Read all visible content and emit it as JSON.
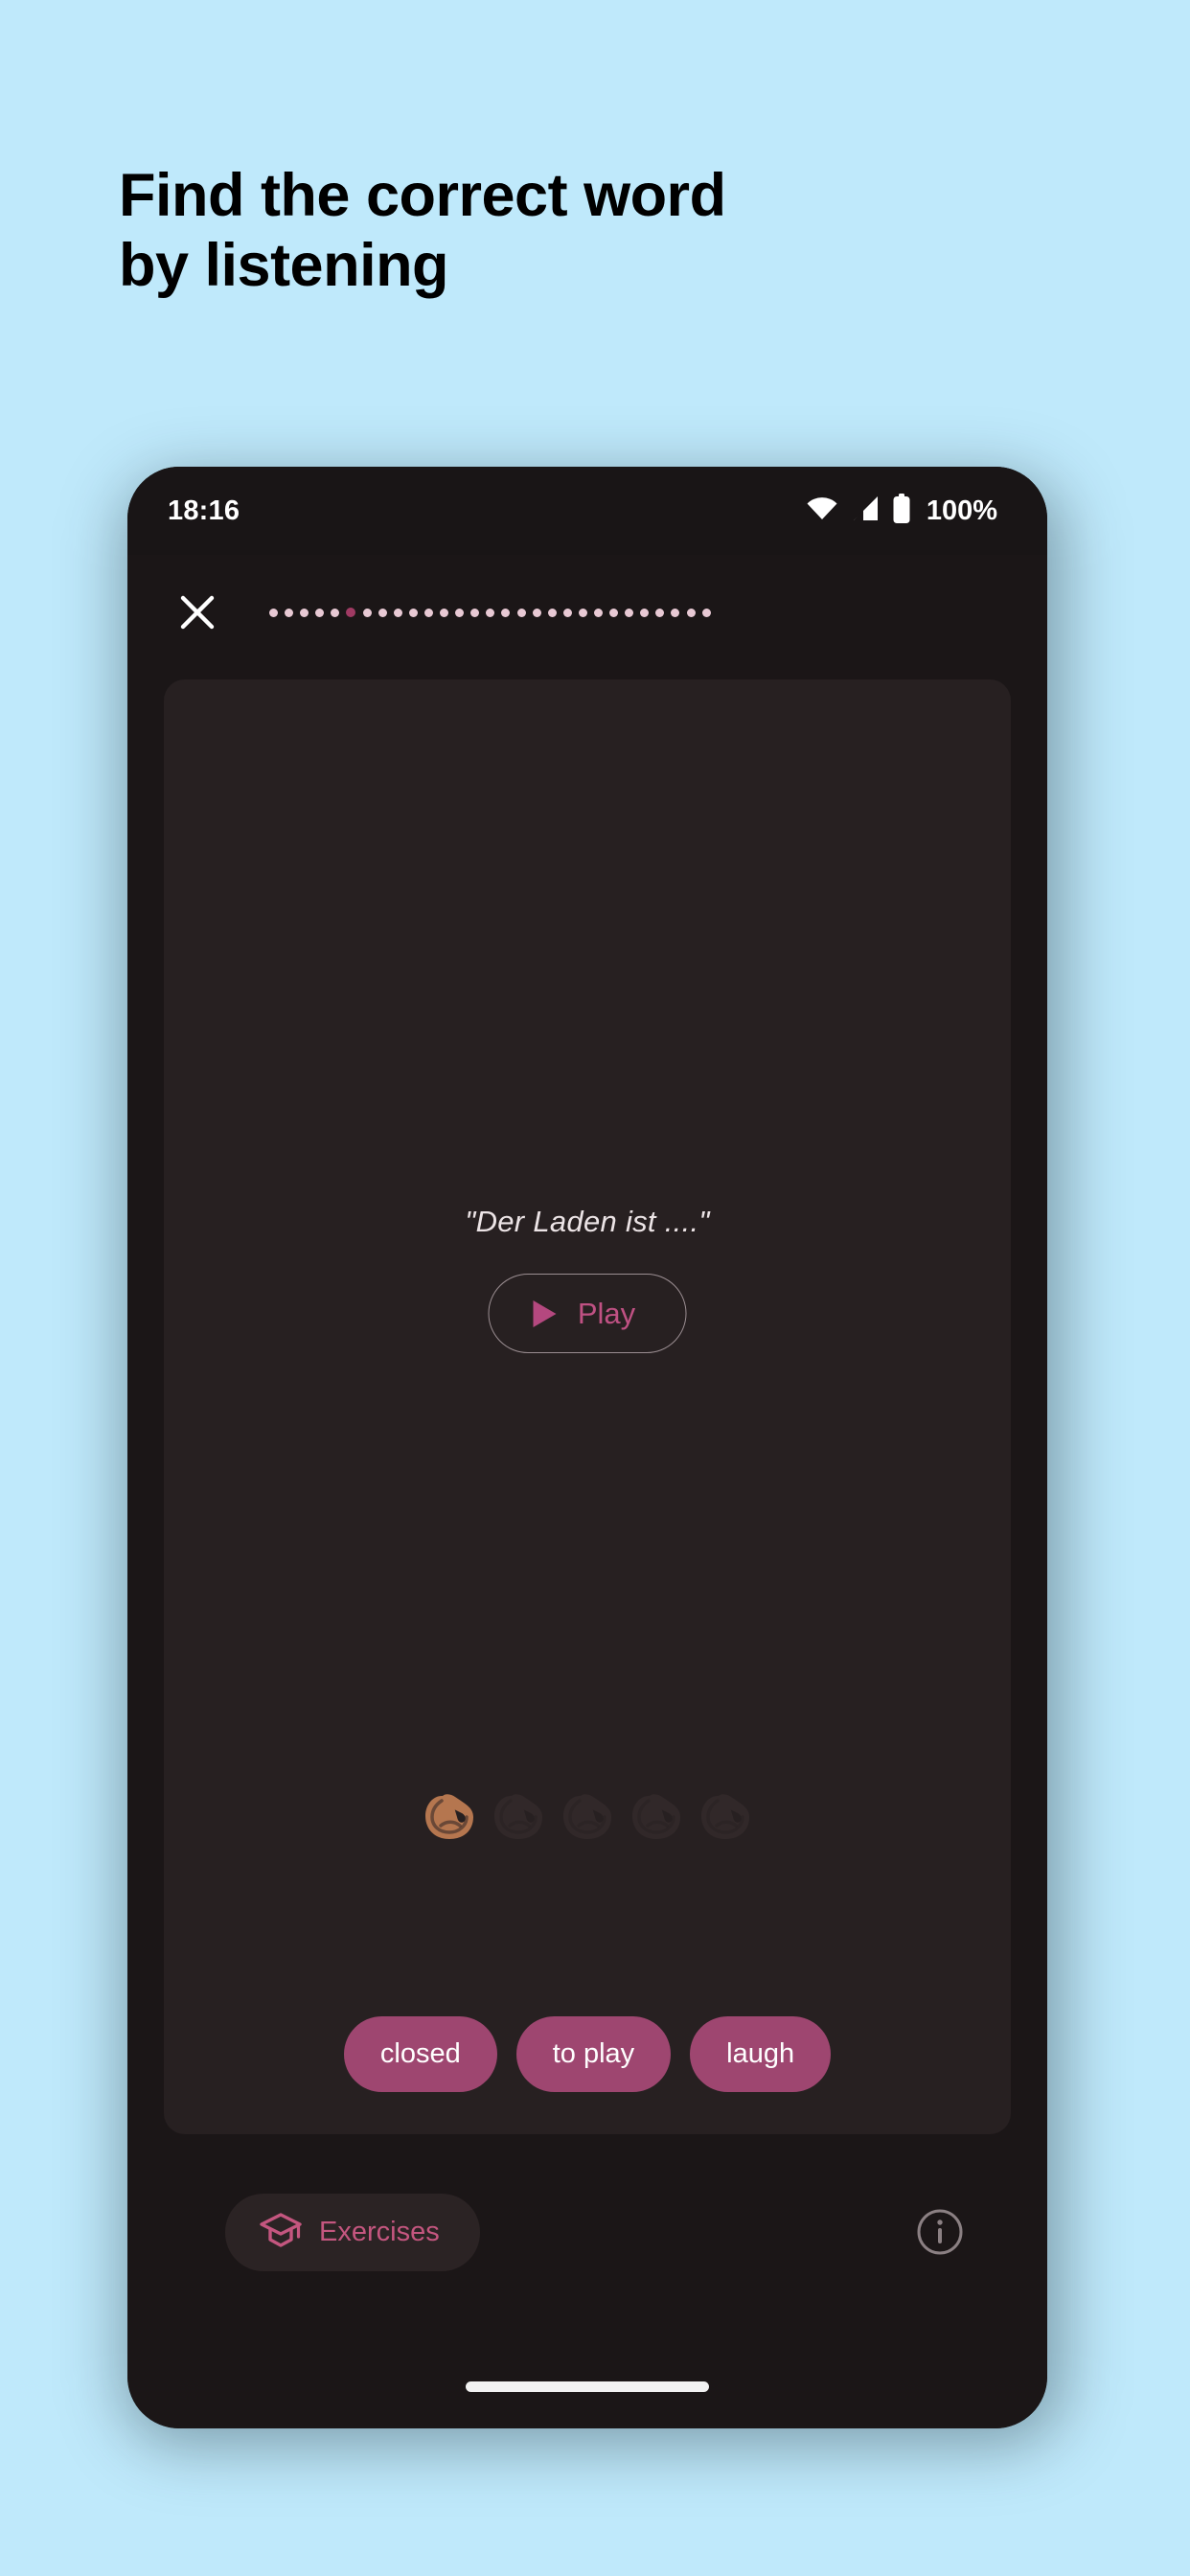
{
  "promo": {
    "heading_line1": "Find the correct word",
    "heading_line2": "by listening",
    "background_color": "#bfe9fb",
    "text_color": "#000000"
  },
  "phone": {
    "status_bar": {
      "time": "18:16",
      "battery_percent": "100%",
      "wifi_icon": "wifi-icon",
      "signal_icon": "cellular-signal-icon",
      "battery_icon": "battery-full-icon"
    },
    "top_bar": {
      "close_icon": "close-icon",
      "progress": {
        "total": 29,
        "current_index": 5,
        "dot_color": "#e8c9d4",
        "active_dot_color": "#a03a63"
      }
    },
    "exercise": {
      "prompt_sentence": "\"Der Laden ist ....\"",
      "play_button": {
        "label": "Play",
        "icon": "play-triangle-icon",
        "color": "#bf5183"
      },
      "lives": {
        "icon": "pretzel-icon",
        "total": 5,
        "remaining": 1,
        "active_color": "#b5764f",
        "dim_color": "#3a2f30"
      },
      "options": [
        {
          "label": "closed"
        },
        {
          "label": "to play"
        },
        {
          "label": "laugh"
        }
      ],
      "option_color": "#9e4670",
      "card_color": "#272021"
    },
    "bottom_nav": {
      "exercises": {
        "label": "Exercises",
        "icon": "graduation-cap-icon",
        "color": "#c4567f",
        "selected": true
      },
      "info": {
        "icon": "info-circle-icon"
      }
    }
  }
}
